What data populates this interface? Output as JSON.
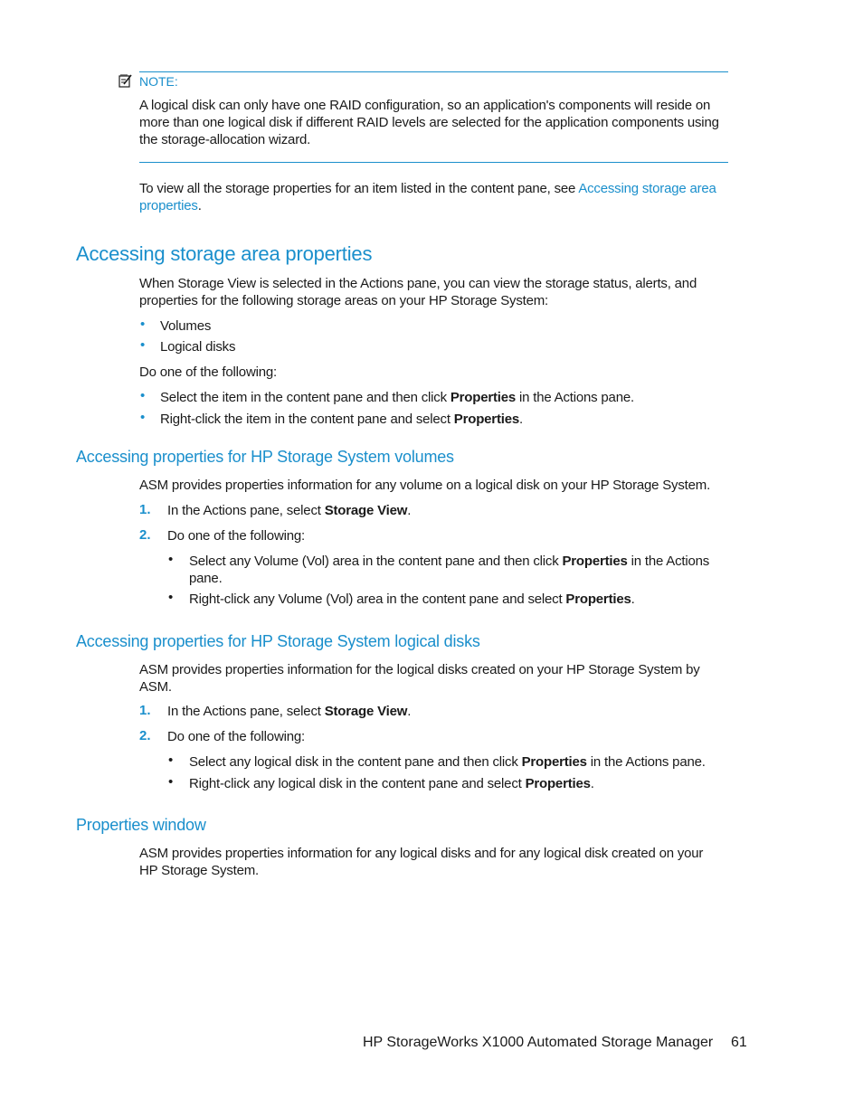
{
  "note": {
    "label": "NOTE:",
    "icon": "note-pencil-icon",
    "text_line1": "A logical disk can only have one RAID configuration, so an application's components will reside on",
    "text_line2": "more than one logical disk if different RAID levels are selected for the application components using",
    "text_line3": "the storage-allocation wizard."
  },
  "intro": {
    "text_pre": "To view all the storage properties for an item listed in the content pane, see ",
    "link_part1": "Accessing storage area",
    "link_part2": "properties",
    "text_post": "."
  },
  "section_main": {
    "title": "Accessing storage area properties",
    "para_line1": "When Storage View is selected in the Actions pane, you can view the storage status, alerts, and",
    "para_line2": "properties for the following storage areas on your HP Storage System:",
    "areas": [
      "Volumes",
      "Logical disks"
    ],
    "do_one": "Do one of the following:",
    "options": [
      {
        "pre": "Select the item in the content pane and then click ",
        "bold": "Properties",
        "post": " in the Actions pane."
      },
      {
        "pre": "Right-click the item in the content pane and select ",
        "bold": "Properties",
        "post": "."
      }
    ]
  },
  "section_volumes": {
    "title": "Accessing properties for HP Storage System volumes",
    "para": "ASM provides properties information for any volume on a logical disk on your HP Storage System.",
    "steps": [
      {
        "num": "1.",
        "pre": "In the Actions pane, select ",
        "bold": "Storage View",
        "post": "."
      },
      {
        "num": "2.",
        "text": "Do one of the following:"
      }
    ],
    "substeps": [
      {
        "pre": "Select any Volume (Vol) area in the content pane and then click ",
        "bold": "Properties",
        "post": " in the Actions",
        "cont": "pane."
      },
      {
        "pre": "Right-click any Volume (Vol) area in the content pane and select ",
        "bold": "Properties",
        "post": "."
      }
    ]
  },
  "section_disks": {
    "title": "Accessing properties for HP Storage System logical disks",
    "para_line1": "ASM provides properties information for the logical disks created on your HP Storage System by",
    "para_line2": "ASM.",
    "steps": [
      {
        "num": "1.",
        "pre": "In the Actions pane, select ",
        "bold": "Storage View",
        "post": "."
      },
      {
        "num": "2.",
        "text": "Do one of the following:"
      }
    ],
    "substeps": [
      {
        "pre": "Select any logical disk in the content pane and then click ",
        "bold": "Properties",
        "post": " in the Actions pane."
      },
      {
        "pre": "Right-click any logical disk in the content pane and select ",
        "bold": "Properties",
        "post": "."
      }
    ]
  },
  "section_window": {
    "title": "Properties window",
    "para_line1": "ASM provides properties information for any logical disks and for any logical disk created on your",
    "para_line2": "HP Storage System."
  },
  "footer": {
    "product": "HP StorageWorks X1000 Automated Storage Manager",
    "page_number": "61"
  },
  "colors": {
    "accent": "#1a8fcc",
    "text": "#1a1a1a"
  }
}
